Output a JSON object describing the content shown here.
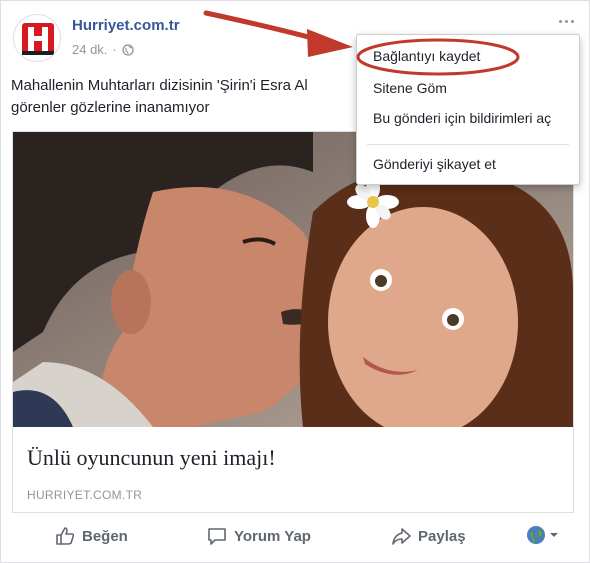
{
  "post": {
    "page_name": "Hurriyet.com.tr",
    "time": "24 dk.",
    "separator": "·",
    "text_line1": "Mahallenin Muhtarları dizisinin 'Şirin'i Esra Al",
    "text_line2": "görenler gözlerine inanamıyor"
  },
  "preview": {
    "title": "Ünlü oyuncunun yeni imajı!",
    "domain": "HURRIYET.COM.TR"
  },
  "actions": {
    "like": "Beğen",
    "comment": "Yorum Yap",
    "share": "Paylaş"
  },
  "menu": {
    "items": [
      "Bağlantıyı kaydet",
      "Sitene Göm",
      "Bu gönderi için bildirimleri aç",
      "Gönderiyi şikayet et"
    ]
  },
  "colors": {
    "link_blue": "#365899",
    "annotation_red": "#c0392b",
    "text_gray": "#606770"
  },
  "icons": [
    "hurriyet-logo",
    "globe-icon",
    "more-options-icon",
    "like-icon",
    "comment-icon",
    "share-icon",
    "audience-globe-icon",
    "chevron-down-icon"
  ]
}
